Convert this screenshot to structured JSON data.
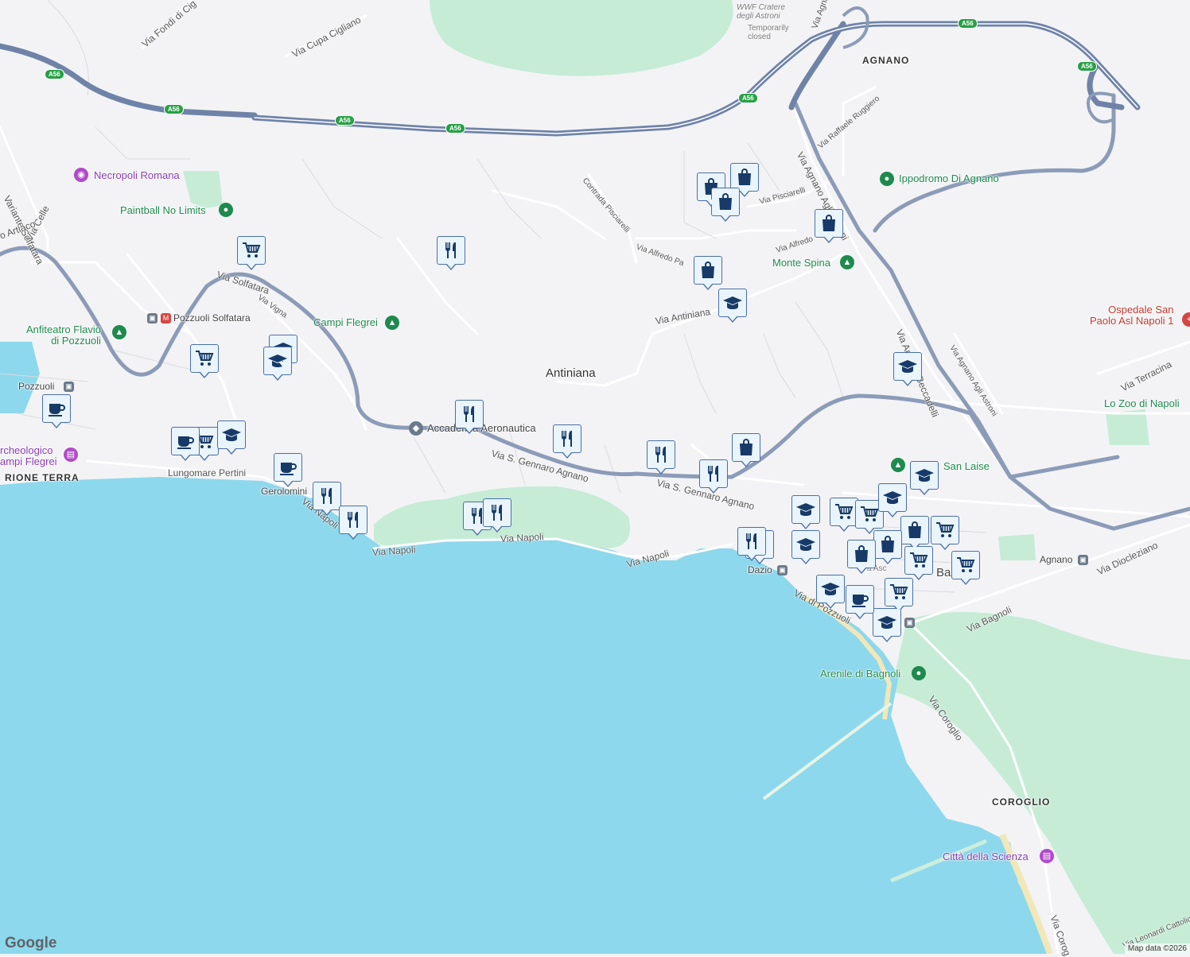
{
  "map": {
    "colors": {
      "land": "#f3f3f5",
      "water": "#8dd8ec",
      "park": "#c6ecd6",
      "highway": "#7b8fb0",
      "road": "#ffffff",
      "marker_fill": "#e9f4fb",
      "marker_border": "#4c6fa6",
      "icon": "#173a68"
    },
    "branding": "Google",
    "attribution": "Map data ©2026"
  },
  "labels": {
    "antiniana": "Antiniana",
    "agnano": "AGNANO",
    "rione_terra": "RIONE TERRA",
    "coroglio": "COROGLIO",
    "wwf": "WWF Cratere\ndegli Astroni",
    "wwf_status": "Temporarily\nclosed",
    "necropoli": "Necropoli Romana",
    "paintball": "Paintball No Limits",
    "anfiteatro": "Anfiteatro Flavio\ndi Pozzuoli",
    "pozzuoli_solfatara": "Pozzuoli Solfatara",
    "pozzuoli": "Pozzuoli",
    "archeologico": "rcheologico\nampi Flegrei",
    "campi_flegrei": "Campi Flegrei",
    "accademia": "Accademia Aeronautica",
    "ippodromo": "Ippodromo Di Agnano",
    "monte_spina": "Monte Spina",
    "ospedale": "Ospedale San\nPaolo Asl Napoli 1",
    "lo_zoo": "Lo Zoo di Napoli",
    "san_laise": "San Laise",
    "agnano_stop": "Agnano",
    "dazio": "Dazio",
    "arenile": "Arenile di Bagnoli",
    "citta_scienza": "Città della Scienza",
    "gerolomini": "Gerolomini",
    "bagnoli_partial": "Bag",
    "ascanio_partial": "a Asc"
  },
  "roads": {
    "fondi": "Via Fondi di Cig",
    "cupa": "Via Cupa Cigliano",
    "variante": "Variante Solfatara",
    "celle": "Via Celle",
    "artiaco": "o Artiaco",
    "solfatara": "Via Solfatara",
    "vigna": "Via Vigna",
    "lungomare": "Lungomare Pertini",
    "napoli1": "Via Napoli",
    "napoli2": "Via Napoli",
    "napoli3": "Via Napoli",
    "napoli4": "Via Napoli",
    "sgennaro1": "Via S. Gennaro Agnano",
    "sgennaro2": "Via S. Gennaro Agnano",
    "antiniana_rd": "Via Antiniana",
    "pisciarelli_c": "Contrada Pisciarelli",
    "alfredo1": "Via Alfredo Pa",
    "alfredo2": "Via Alfredo",
    "pisciarelli": "Via Pisciarelli",
    "ruggiero": "Via Raffaele Ruggiero",
    "agnano_astroni": "Via Agnano Agli Astroni",
    "agnano_astroni2": "Via Agnano Agli Astroni",
    "beccadelli": "Via Antonio Beccadelli",
    "terracina": "Via Terracina",
    "diocleziano": "Via Diocleziano",
    "bagnoli": "Via Bagnoli",
    "pozzuoli_rd": "Via di Pozzuoli",
    "coroglio": "Via Coroglio",
    "coroglio2": "Via Corog",
    "cattolica": "Via Leonardi Cattolica",
    "agna_top": "Via Agna"
  },
  "highway": {
    "shield": "A56"
  },
  "markers": [
    {
      "type": "restaurant"
    },
    {
      "type": "restaurant"
    },
    {
      "type": "restaurant"
    },
    {
      "type": "restaurant"
    },
    {
      "type": "restaurant"
    },
    {
      "type": "restaurant"
    },
    {
      "type": "restaurant"
    },
    {
      "type": "restaurant"
    },
    {
      "type": "restaurant"
    },
    {
      "type": "restaurant"
    },
    {
      "type": "restaurant"
    },
    {
      "type": "shopping"
    },
    {
      "type": "shopping"
    },
    {
      "type": "shopping"
    },
    {
      "type": "shopping"
    },
    {
      "type": "shopping"
    },
    {
      "type": "shopping"
    },
    {
      "type": "shopping"
    },
    {
      "type": "shopping"
    },
    {
      "type": "shopping"
    },
    {
      "type": "grocery"
    },
    {
      "type": "grocery"
    },
    {
      "type": "grocery"
    },
    {
      "type": "grocery"
    },
    {
      "type": "grocery"
    },
    {
      "type": "grocery"
    },
    {
      "type": "grocery"
    },
    {
      "type": "grocery"
    },
    {
      "type": "grocery"
    },
    {
      "type": "school"
    },
    {
      "type": "school"
    },
    {
      "type": "school"
    },
    {
      "type": "school"
    },
    {
      "type": "school"
    },
    {
      "type": "school"
    },
    {
      "type": "school"
    },
    {
      "type": "school"
    },
    {
      "type": "school"
    },
    {
      "type": "school"
    },
    {
      "type": "school"
    },
    {
      "type": "cafe"
    },
    {
      "type": "cafe"
    },
    {
      "type": "cafe"
    },
    {
      "type": "cafe"
    }
  ]
}
